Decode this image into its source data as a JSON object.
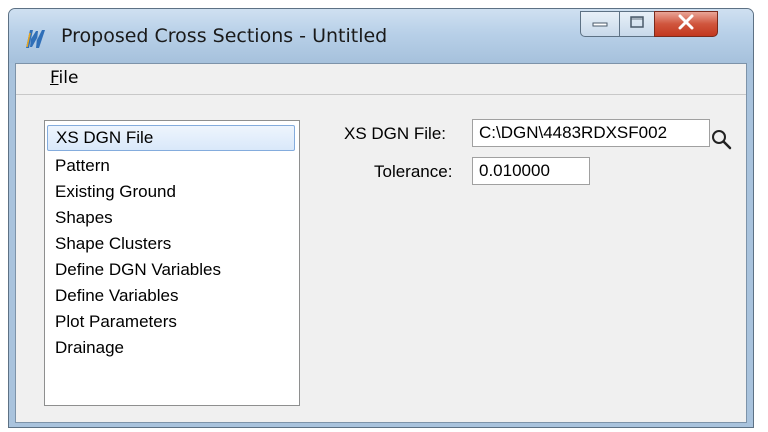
{
  "window": {
    "title": "Proposed Cross Sections - Untitled",
    "icon": "app-logo-icon",
    "controls": [
      "minimize-icon",
      "maximize-icon",
      "close-icon"
    ]
  },
  "menu": {
    "file_underlined": "F",
    "file_rest": "ile"
  },
  "nav_list": {
    "items": [
      {
        "label": "XS DGN File",
        "selected": true
      },
      {
        "label": "Pattern"
      },
      {
        "label": "Existing Ground"
      },
      {
        "label": "Shapes"
      },
      {
        "label": "Shape Clusters"
      },
      {
        "label": "Define DGN Variables"
      },
      {
        "label": "Define Variables"
      },
      {
        "label": "Plot Parameters"
      },
      {
        "label": "Drainage"
      }
    ]
  },
  "form": {
    "xs_dgn_file_label": "XS DGN File:",
    "xs_dgn_file_value": "C:\\DGN\\4483RDXSF002",
    "tolerance_label": "Tolerance:",
    "tolerance_value": "0.010000",
    "browse_icon": "search-icon"
  },
  "colors": {
    "selection_border": "#84acdd",
    "close_button": "#c2381f"
  }
}
